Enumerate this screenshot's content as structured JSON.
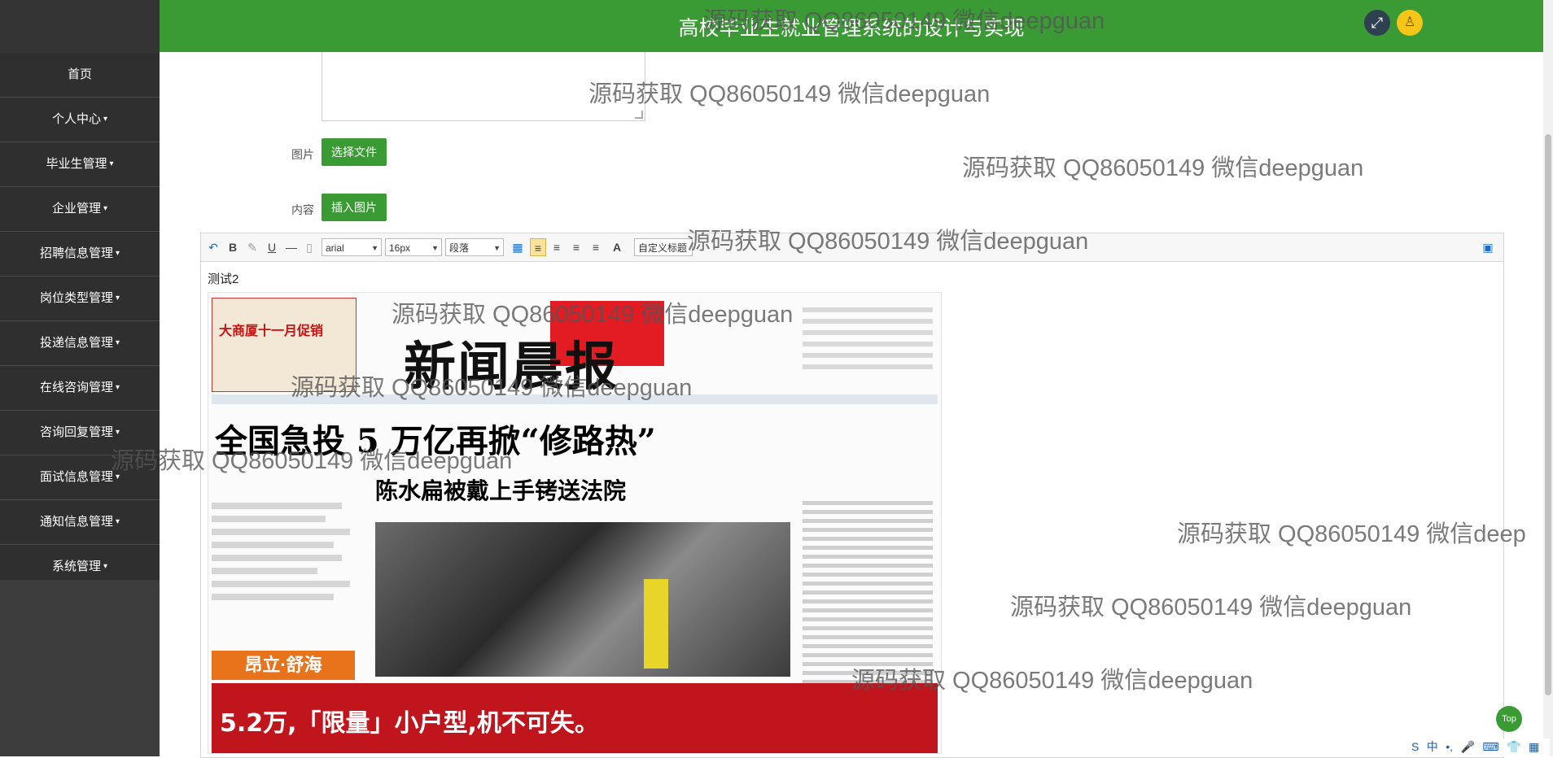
{
  "header": {
    "title": "高校毕业生就业管理系统的设计与实现",
    "fullscreen_icon": "⤢",
    "user_icon": "♙"
  },
  "sidebar": {
    "items": [
      {
        "label": "首页",
        "dropdown": false
      },
      {
        "label": "个人中心",
        "dropdown": true
      },
      {
        "label": "毕业生管理",
        "dropdown": true
      },
      {
        "label": "企业管理",
        "dropdown": true
      },
      {
        "label": "招聘信息管理",
        "dropdown": true
      },
      {
        "label": "岗位类型管理",
        "dropdown": true
      },
      {
        "label": "投递信息管理",
        "dropdown": true
      },
      {
        "label": "在线咨询管理",
        "dropdown": true
      },
      {
        "label": "咨询回复管理",
        "dropdown": true
      },
      {
        "label": "面试信息管理",
        "dropdown": true
      },
      {
        "label": "通知信息管理",
        "dropdown": true
      },
      {
        "label": "系统管理",
        "dropdown": true
      }
    ],
    "caret": "▾"
  },
  "form": {
    "image_label": "图片",
    "choose_file_button": "选择文件",
    "content_label": "内容",
    "insert_image_button": "插入图片"
  },
  "editor": {
    "toolbar": {
      "undo": "↶",
      "bold": "B",
      "format_painter": "✎",
      "underline": "U",
      "hr": "—",
      "doc": "▯",
      "font_family": "arial",
      "font_size": "16px",
      "paragraph": "段落",
      "table": "▦",
      "align_left": "≡",
      "align_center": "≡",
      "align_right": "≡",
      "justify": "≡",
      "font_color": "A",
      "custom_title": "自定义标题",
      "source": "▣"
    },
    "text": "测试2"
  },
  "newspaper": {
    "masthead": "新闻晨报",
    "headline": "全国急投 5 万亿再掀“修路热”",
    "subheadline": "陈水扁被戴上手铐送法院",
    "ad_left_title": "大商厦十一月促销",
    "orange_banner": "昂立·舒海",
    "bottom_ad": "5.2万,「限量」小户型,机不可失。"
  },
  "watermark": "源码获取 QQ86050149 微信deepguan",
  "watermark_partial": "源码获取 QQ86050149 微信deep",
  "float_button": "Top",
  "tray": [
    "S",
    "中",
    "•,",
    "🎤",
    "⌨",
    "👕",
    "▦"
  ]
}
